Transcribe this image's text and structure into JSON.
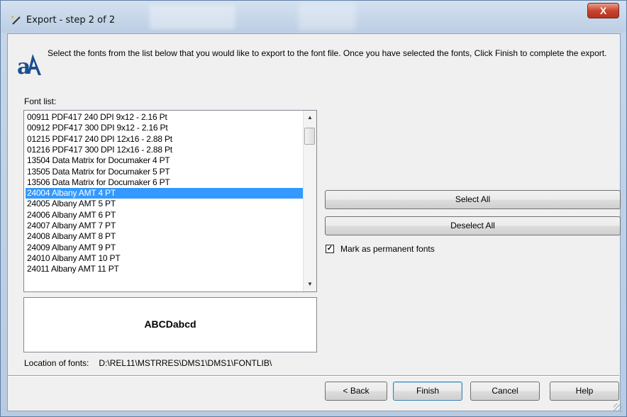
{
  "window": {
    "title": "Export - step 2 of 2",
    "close_label": "X"
  },
  "intro": {
    "text": "Select the fonts from the list below that you would like to export to the font file. Once you have selected the fonts, Click Finish to complete the export."
  },
  "font_list": {
    "label": "Font list:",
    "items": [
      "00911  PDF417 240 DPI 9x12 - 2.16 Pt",
      "00912  PDF417 300 DPI 9x12 - 2.16 Pt",
      "01215  PDF417 240 DPI 12x16 - 2.88 Pt",
      "01216  PDF417 300 DPI 12x16 - 2.88 Pt",
      "13504  Data Matrix for Documaker 4 PT",
      "13505  Data Matrix for Documaker 5 PT",
      "13506  Data Matrix for Documaker 6 PT",
      "24004  Albany AMT 4 PT",
      "24005  Albany AMT 5 PT",
      "24006  Albany AMT 6 PT",
      "24007  Albany AMT 7 PT",
      "24008  Albany AMT 8 PT",
      "24009  Albany AMT 9 PT",
      "24010  Albany AMT 10 PT",
      "24011  Albany AMT 11 PT"
    ],
    "selected_index": 7
  },
  "preview": {
    "sample_text": "ABCDabcd"
  },
  "buttons": {
    "select_all": "Select All",
    "deselect_all": "Deselect All",
    "back": "< Back",
    "finish": "Finish",
    "cancel": "Cancel",
    "help": "Help"
  },
  "permanent_checkbox": {
    "label": "Mark as permanent fonts",
    "checked": true
  },
  "location": {
    "label": "Location of fonts:",
    "path": "D:\\REL11\\MSTRRES\\DMS1\\DMS1\\FONTLIB\\"
  }
}
